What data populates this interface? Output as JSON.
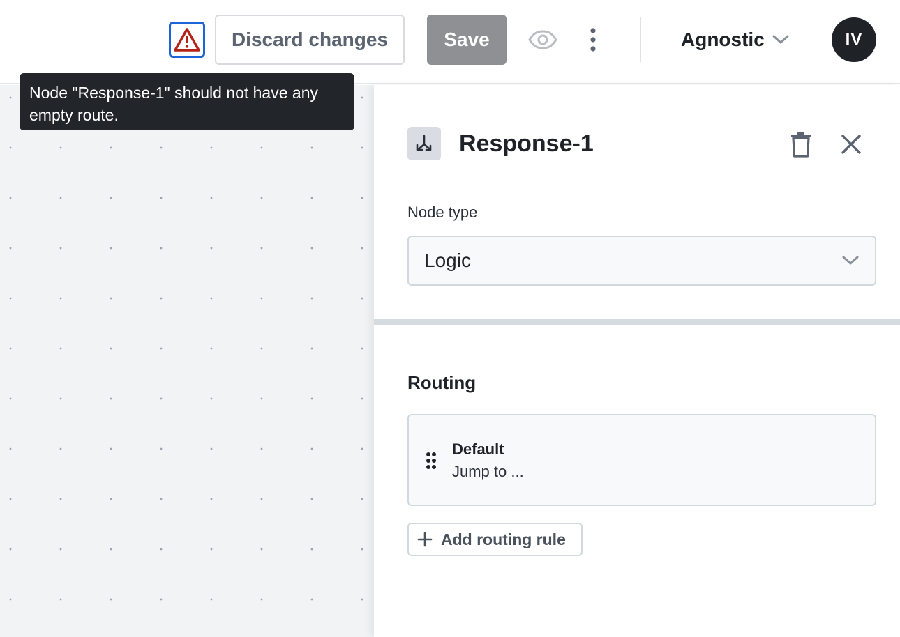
{
  "header": {
    "discard_label": "Discard changes",
    "save_label": "Save",
    "workspace_name": "Agnostic",
    "avatar_initials": "IV",
    "warning_icon": "warning-triangle-icon",
    "preview_icon": "eye-icon",
    "more_icon": "more-vertical-icon"
  },
  "tooltip": {
    "text": "Node \"Response-1\" should not have any empty route."
  },
  "panel": {
    "node_title": "Response-1",
    "node_icon": "merge-arrows-icon",
    "field_label": "Node type",
    "node_type_value": "Logic",
    "routing_title": "Routing",
    "routes": [
      {
        "name": "Default",
        "target": "Jump to ..."
      }
    ],
    "add_rule_label": "Add routing rule"
  },
  "colors": {
    "warning": "#b42318",
    "focus_ring": "#1c64d8",
    "save_disabled": "#8e9094",
    "tooltip_bg": "#22262b"
  }
}
